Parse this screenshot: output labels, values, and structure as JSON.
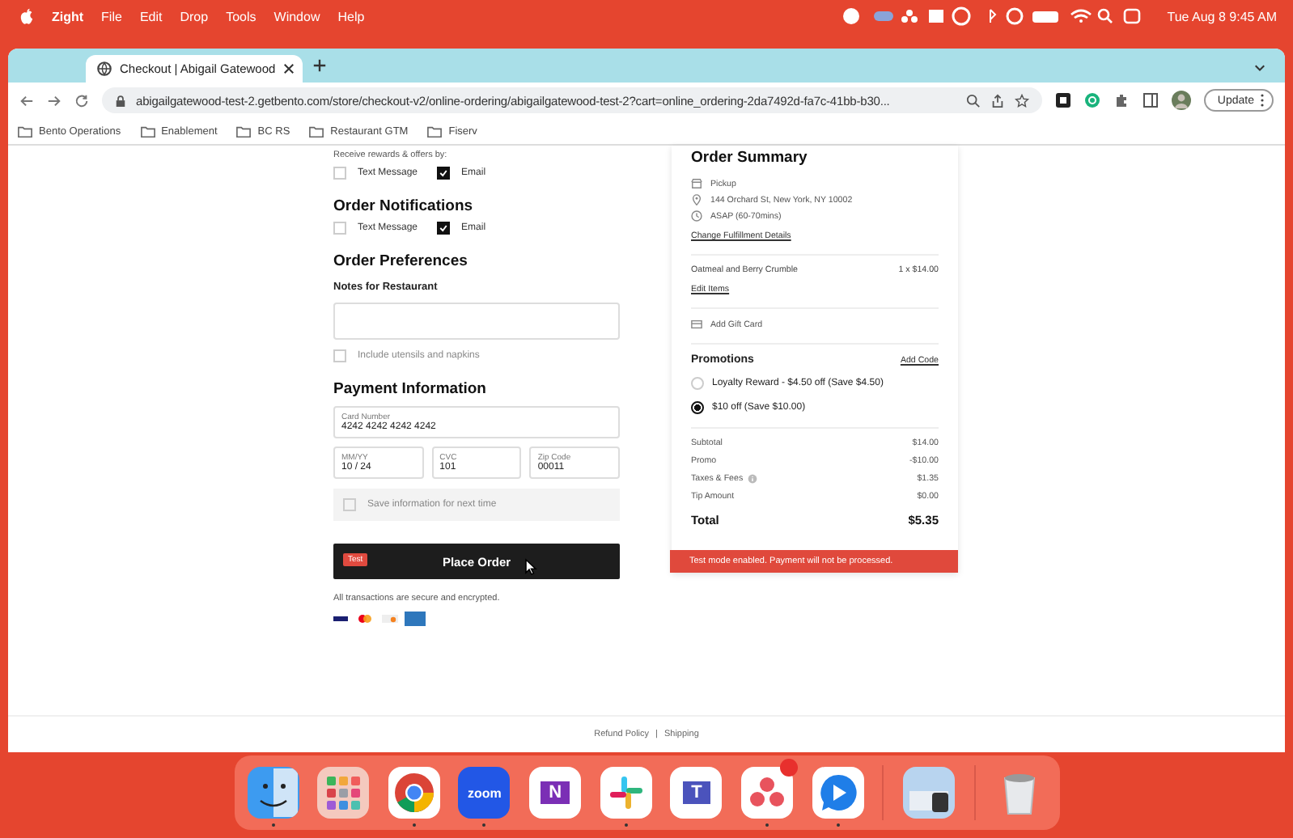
{
  "menu_bar": {
    "app": "Zight",
    "menus": [
      "File",
      "Edit",
      "Drop",
      "Tools",
      "Window",
      "Help"
    ],
    "clock": "Tue Aug 8  9:45 AM"
  },
  "browser": {
    "tab": {
      "title": "Checkout | Abigail Gatewood",
      "selected": true
    },
    "url": "abigailgatewood-test-2.getbento.com/store/checkout-v2/online-ordering/abigailgatewood-test-2?cart=online_ordering-2da7492d-fa7c-41bb-b30...",
    "update_button": "Update",
    "bookmarks": [
      "Bento Operations",
      "Enablement",
      "BC RS",
      "Restaurant GTM",
      "Fiserv"
    ]
  },
  "checkout": {
    "rewards": {
      "label": "Receive rewards & offers by:",
      "options": [
        {
          "label": "Text Message",
          "checked": false
        },
        {
          "label": "Email",
          "checked": true
        }
      ]
    },
    "notifications": {
      "title": "Order Notifications",
      "options": [
        {
          "label": "Text Message",
          "checked": false
        },
        {
          "label": "Email",
          "checked": true
        }
      ]
    },
    "preferences": {
      "title": "Order Preferences",
      "notes_label": "Notes for Restaurant",
      "utensils": {
        "label": "Include utensils and napkins",
        "checked": false
      }
    },
    "payment": {
      "title": "Payment Information",
      "fields": [
        {
          "label": "Card Number",
          "value": "4242 4242 4242 4242"
        },
        {
          "label": "MM/YY",
          "value": "10 / 24"
        },
        {
          "label": "CVC",
          "value": "101"
        },
        {
          "label": "Zip Code",
          "value": "00011"
        }
      ],
      "save": {
        "label": "Save information for next time",
        "checked": false
      }
    },
    "place_order": {
      "badge": "Test",
      "label": "Place Order"
    },
    "secure_note": "All transactions are secure and encrypted."
  },
  "summary": {
    "title": "Order Summary",
    "details": [
      {
        "kind": "pickup",
        "text": "Pickup"
      },
      {
        "kind": "location",
        "text": "144 Orchard St, New York, NY 10002"
      },
      {
        "kind": "time",
        "text": "ASAP (60-70mins)"
      }
    ],
    "change_link": "Change Fulfillment Details",
    "items": [
      {
        "name": "Oatmeal and Berry Crumble",
        "price": "1 x $14.00"
      }
    ],
    "edit_link": "Edit Items",
    "gift_card": "Add Gift Card",
    "promotions": {
      "title": "Promotions",
      "add_code": "Add Code",
      "options": [
        {
          "label": "Loyalty Reward - $4.50 off (Save $4.50)",
          "selected": false
        },
        {
          "label": "$10 off (Save $10.00)",
          "selected": true
        }
      ]
    },
    "totals": [
      {
        "label": "Subtotal",
        "value": "$14.00",
        "info": false
      },
      {
        "label": "Promo",
        "value": "-$10.00",
        "info": false
      },
      {
        "label": "Taxes & Fees",
        "value": "$1.35",
        "info": true
      },
      {
        "label": "Tip Amount",
        "value": "$0.00",
        "info": false
      }
    ],
    "total": {
      "label": "Total",
      "value": "$5.35"
    },
    "alert": "Test mode enabled. Payment will not be processed."
  },
  "footer": {
    "links": [
      "Refund Policy",
      "Shipping"
    ],
    "separator": "|"
  },
  "dock": {
    "apps": [
      {
        "kind": "finder",
        "running": true,
        "badge": false
      },
      {
        "kind": "launchpad",
        "running": false,
        "badge": false
      },
      {
        "kind": "chrome",
        "running": true,
        "badge": false
      },
      {
        "kind": "zoom",
        "label": "zoom",
        "running": true,
        "badge": false
      },
      {
        "kind": "onenote",
        "label": "N",
        "running": false,
        "badge": false
      },
      {
        "kind": "slack",
        "running": true,
        "badge": false
      },
      {
        "kind": "teams",
        "label": "T",
        "running": false,
        "badge": false
      },
      {
        "kind": "asana",
        "running": true,
        "badge": true
      },
      {
        "kind": "chat",
        "running": true,
        "badge": false
      },
      {
        "kind": "preview",
        "running": false,
        "badge": false
      },
      {
        "kind": "trash",
        "running": false,
        "badge": false
      }
    ]
  }
}
